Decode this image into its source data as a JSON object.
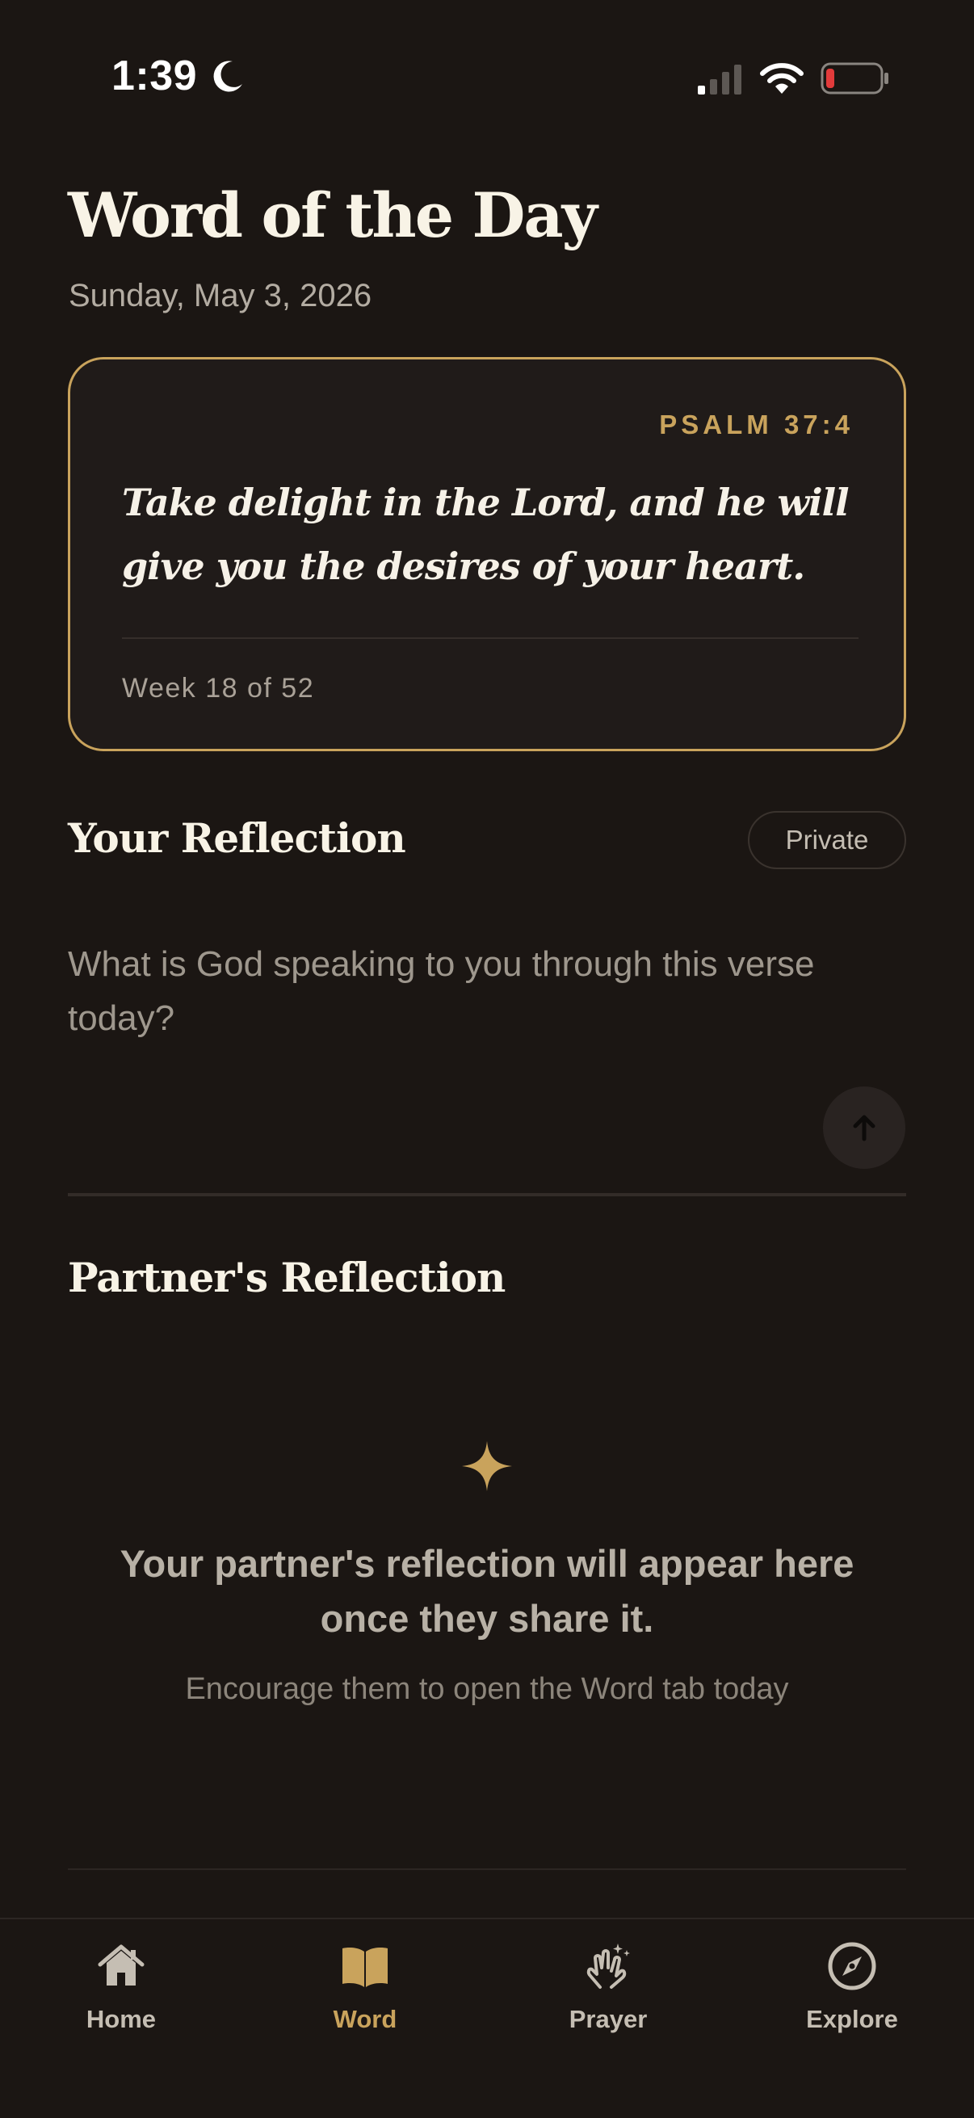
{
  "status_bar": {
    "time": "1:39",
    "icons": [
      "moon-icon",
      "signal-icon",
      "wifi-icon",
      "battery-icon"
    ],
    "battery_color": "#e23b3b"
  },
  "header": {
    "title": "Word of the Day",
    "date": "Sunday, May 3, 2026"
  },
  "verse": {
    "reference": "PSALM 37:4",
    "text": "Take delight in the Lord, and he will give you the desires of your heart.",
    "week": "Week 18 of 52"
  },
  "your_reflection": {
    "title": "Your Reflection",
    "badge": "Private",
    "placeholder": "What is God speaking to you through this verse today?",
    "value": "",
    "send_icon": "arrow-up-icon"
  },
  "partner_reflection": {
    "title": "Partner's Reflection",
    "icon": "sparkle-icon",
    "empty_message": "Your partner's reflection will appear here once they share it.",
    "hint": "Encourage them to open the Word tab today"
  },
  "tab_bar": {
    "active": "Word",
    "items": [
      {
        "label": "Home",
        "icon": "home-icon"
      },
      {
        "label": "Word",
        "icon": "book-icon"
      },
      {
        "label": "Prayer",
        "icon": "praying-hands-icon"
      },
      {
        "label": "Explore",
        "icon": "compass-icon"
      }
    ]
  },
  "colors": {
    "background": "#1b1613",
    "accent": "#c9a35c",
    "card_background": "#201b19",
    "text_primary": "#f6f1e7",
    "text_secondary": "#b3aca2"
  }
}
